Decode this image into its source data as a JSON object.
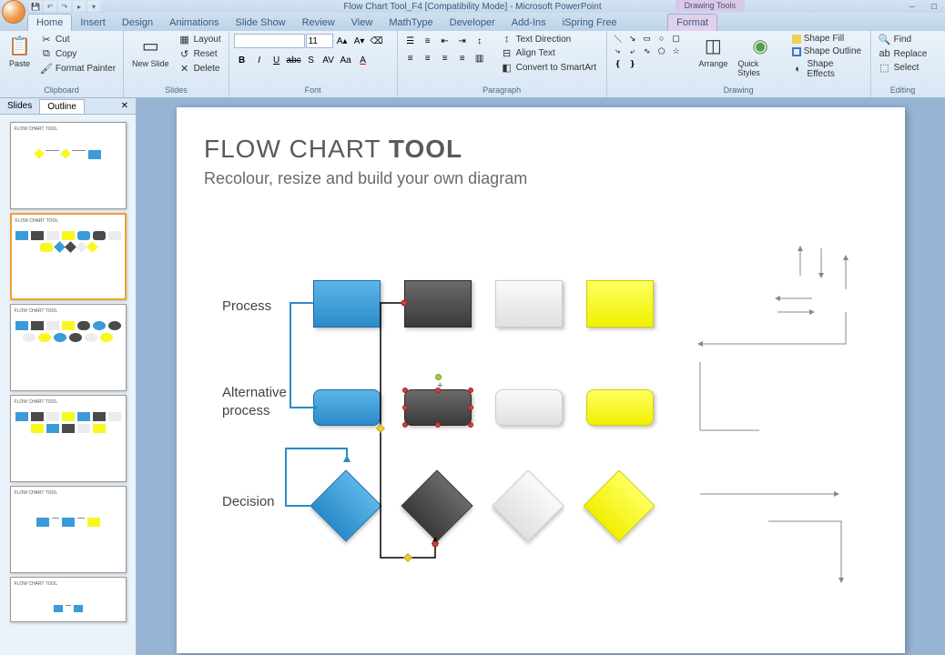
{
  "app": {
    "title": "Flow Chart Tool_F4 [Compatibility Mode] - Microsoft PowerPoint",
    "contextual_tab": "Drawing Tools"
  },
  "tabs": {
    "home": "Home",
    "insert": "Insert",
    "design": "Design",
    "animations": "Animations",
    "slideshow": "Slide Show",
    "review": "Review",
    "view": "View",
    "mathtype": "MathType",
    "developer": "Developer",
    "addins": "Add-Ins",
    "ispring": "iSpring Free",
    "format": "Format"
  },
  "ribbon": {
    "clipboard": {
      "label": "Clipboard",
      "paste": "Paste",
      "cut": "Cut",
      "copy": "Copy",
      "format_painter": "Format Painter"
    },
    "slides": {
      "label": "Slides",
      "new_slide": "New Slide",
      "layout": "Layout",
      "reset": "Reset",
      "delete": "Delete"
    },
    "font": {
      "label": "Font",
      "size": "11"
    },
    "paragraph": {
      "label": "Paragraph",
      "text_direction": "Text Direction",
      "align_text": "Align Text",
      "convert_smartart": "Convert to SmartArt"
    },
    "drawing": {
      "label": "Drawing",
      "arrange": "Arrange",
      "quick_styles": "Quick Styles",
      "shape_fill": "Shape Fill",
      "shape_outline": "Shape Outline",
      "shape_effects": "Shape Effects"
    },
    "editing": {
      "label": "Editing",
      "find": "Find",
      "replace": "Replace",
      "select": "Select"
    }
  },
  "panel": {
    "slides_tab": "Slides",
    "outline_tab": "Outline"
  },
  "slide": {
    "title_part1": "FLOW CHART ",
    "title_part2": "TOOL",
    "subtitle": "Recolour, resize and build your own diagram",
    "row_process": "Process",
    "row_altprocess1": "Alternative",
    "row_altprocess2": "process",
    "row_decision": "Decision"
  },
  "colors": {
    "blue": "#3a9bd8",
    "dark": "#4a4a4a",
    "gray": "#ececec",
    "yellow": "#f8f820"
  }
}
